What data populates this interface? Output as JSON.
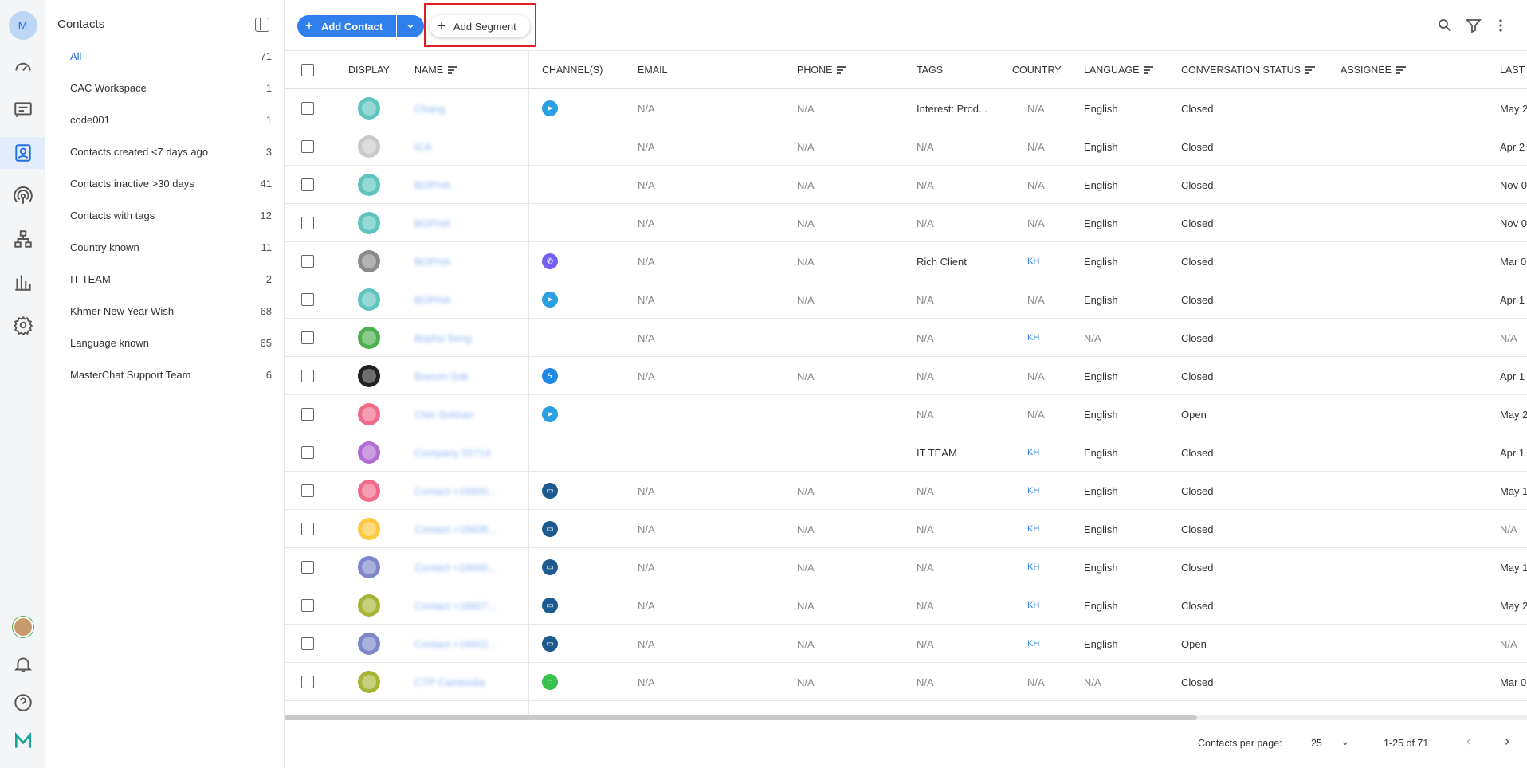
{
  "rail": {
    "user_initial": "M",
    "icons": [
      "dashboard-icon",
      "conversations-icon",
      "contacts-icon",
      "broadcast-icon",
      "workflow-icon",
      "reports-icon",
      "settings-icon"
    ],
    "bottom_icons": [
      "profile-avatar",
      "notifications-icon",
      "help-icon",
      "logo-icon"
    ]
  },
  "segments": {
    "title": "Contacts",
    "items": [
      {
        "label": "All",
        "count": "71"
      },
      {
        "label": "CAC Workspace",
        "count": "1"
      },
      {
        "label": "code001",
        "count": "1"
      },
      {
        "label": "Contacts created <7 days ago",
        "count": "3"
      },
      {
        "label": "Contacts inactive >30 days",
        "count": "41"
      },
      {
        "label": "Contacts with tags",
        "count": "12"
      },
      {
        "label": "Country known",
        "count": "11"
      },
      {
        "label": "IT TEAM",
        "count": "2"
      },
      {
        "label": "Khmer New Year Wish",
        "count": "68"
      },
      {
        "label": "Language known",
        "count": "65"
      },
      {
        "label": "MasterChat Support Team",
        "count": "6"
      }
    ]
  },
  "toolbar": {
    "add_contact": "Add Contact",
    "add_segment": "Add Segment"
  },
  "table": {
    "headers": {
      "display": "DISPLAY",
      "name": "NAME",
      "channels": "CHANNEL(S)",
      "email": "EMAIL",
      "phone": "PHONE",
      "tags": "TAGS",
      "country": "COUNTRY",
      "language": "LANGUAGE",
      "conversation_status": "CONVERSATION STATUS",
      "assignee": "ASSIGNEE",
      "last": "LAST"
    },
    "rows": [
      {
        "avatar_color": "#5ec4bd",
        "name": "Chang",
        "channel": "telegram",
        "email": "N/A",
        "phone": "N/A",
        "tags": "Interest: Prod...",
        "country": "N/A",
        "language": "English",
        "status": "Closed",
        "assignee": "",
        "last": "May 2"
      },
      {
        "avatar_color": "#c9c9c9",
        "name": "ICA",
        "channel": "",
        "email": "N/A",
        "phone": "N/A",
        "tags": "N/A",
        "country": "N/A",
        "language": "English",
        "status": "Closed",
        "assignee": "",
        "last": "Apr 2"
      },
      {
        "avatar_color": "#5ec4bd",
        "name": "BOPHA",
        "channel": "",
        "email": "N/A",
        "phone": "N/A",
        "tags": "N/A",
        "country": "N/A",
        "language": "English",
        "status": "Closed",
        "assignee": "",
        "last": "Nov 0"
      },
      {
        "avatar_color": "#5ec4bd",
        "name": "BOPHA",
        "channel": "",
        "email": "N/A",
        "phone": "N/A",
        "tags": "N/A",
        "country": "N/A",
        "language": "English",
        "status": "Closed",
        "assignee": "",
        "last": "Nov 0"
      },
      {
        "avatar_color": "#8a8a8a",
        "name": "BOPHA",
        "channel": "viber",
        "email": "N/A",
        "phone": "N/A",
        "tags": "Rich Client",
        "country": "KH",
        "language": "English",
        "status": "Closed",
        "assignee": "",
        "last": "Mar 0"
      },
      {
        "avatar_color": "#5ec4bd",
        "name": "BOPHA",
        "channel": "telegram",
        "email": "N/A",
        "phone": "N/A",
        "tags": "N/A",
        "country": "N/A",
        "language": "English",
        "status": "Closed",
        "assignee": "",
        "last": "Apr 1"
      },
      {
        "avatar_color": "#4caf50",
        "name": "Bopha Seng",
        "channel": "",
        "email": "N/A",
        "phone": "",
        "tags": "N/A",
        "country": "KH",
        "language": "N/A",
        "status": "Closed",
        "assignee": "",
        "last": "N/A"
      },
      {
        "avatar_color": "#222222",
        "name": "Boeurn Sok",
        "channel": "messenger",
        "email": "N/A",
        "phone": "N/A",
        "tags": "N/A",
        "country": "N/A",
        "language": "English",
        "status": "Closed",
        "assignee": "",
        "last": "Apr 1"
      },
      {
        "avatar_color": "#f06a8a",
        "name": "Chin Sokhan",
        "channel": "telegram",
        "email": "",
        "phone": "",
        "tags": "N/A",
        "country": "N/A",
        "language": "English",
        "status": "Open",
        "assignee": "",
        "last": "May 2"
      },
      {
        "avatar_color": "#b26bd1",
        "name": "Company 55714",
        "channel": "",
        "email": "",
        "phone": "",
        "tags": "IT TEAM",
        "country": "KH",
        "language": "English",
        "status": "Closed",
        "assignee": "",
        "last": "Apr 1"
      },
      {
        "avatar_color": "#f06a8a",
        "name": "Contact +16600...",
        "channel": "sms",
        "email": "N/A",
        "phone": "N/A",
        "tags": "N/A",
        "country": "KH",
        "language": "English",
        "status": "Closed",
        "assignee": "",
        "last": "May 1"
      },
      {
        "avatar_color": "#ffc83d",
        "name": "Contact +16608...",
        "channel": "sms",
        "email": "N/A",
        "phone": "N/A",
        "tags": "N/A",
        "country": "KH",
        "language": "English",
        "status": "Closed",
        "assignee": "",
        "last": "N/A"
      },
      {
        "avatar_color": "#7d86c9",
        "name": "Contact +16600...",
        "channel": "sms",
        "email": "N/A",
        "phone": "N/A",
        "tags": "N/A",
        "country": "KH",
        "language": "English",
        "status": "Closed",
        "assignee": "",
        "last": "May 1"
      },
      {
        "avatar_color": "#a7b536",
        "name": "Contact +16607...",
        "channel": "sms",
        "email": "N/A",
        "phone": "N/A",
        "tags": "N/A",
        "country": "KH",
        "language": "English",
        "status": "Closed",
        "assignee": "",
        "last": "May 2"
      },
      {
        "avatar_color": "#7d86c9",
        "name": "Contact +16602...",
        "channel": "sms",
        "email": "N/A",
        "phone": "N/A",
        "tags": "N/A",
        "country": "KH",
        "language": "English",
        "status": "Open",
        "assignee": "",
        "last": "N/A"
      },
      {
        "avatar_color": "#a7b536",
        "name": "CTP Cambodia",
        "channel": "line",
        "email": "N/A",
        "phone": "N/A",
        "tags": "N/A",
        "country": "N/A",
        "language": "N/A",
        "status": "Closed",
        "assignee": "",
        "last": "Mar 0"
      }
    ]
  },
  "footer": {
    "per_page_label": "Contacts per page:",
    "per_page_value": "25",
    "range": "1-25 of 71"
  },
  "colors": {
    "accent": "#2f80ed",
    "highlight": "#e0201f"
  }
}
